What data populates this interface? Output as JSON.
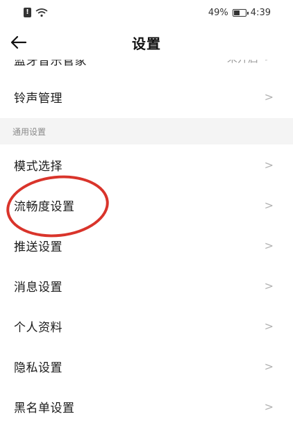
{
  "status_bar": {
    "battery_percent": "49%",
    "time": "4:39",
    "icons": [
      "notification-icon",
      "wifi-icon",
      "battery-icon"
    ]
  },
  "header": {
    "title": "设置",
    "back_icon": "arrow-left-icon"
  },
  "list": {
    "top_partial": {
      "label": "蓝牙音乐管家",
      "value": "未开启"
    },
    "ringtone": {
      "label": "铃声管理"
    },
    "general_section": "通用设置",
    "items": [
      {
        "label": "模式选择"
      },
      {
        "label": "流畅度设置"
      },
      {
        "label": "推送设置"
      },
      {
        "label": "消息设置"
      },
      {
        "label": "个人资料"
      },
      {
        "label": "隐私设置"
      },
      {
        "label": "黑名单设置"
      }
    ]
  },
  "chevron_glyph": ">",
  "colors": {
    "annotation_circle": "#d9342b",
    "section_background": "#f4f4f4",
    "chevron": "#b3b3b3"
  }
}
